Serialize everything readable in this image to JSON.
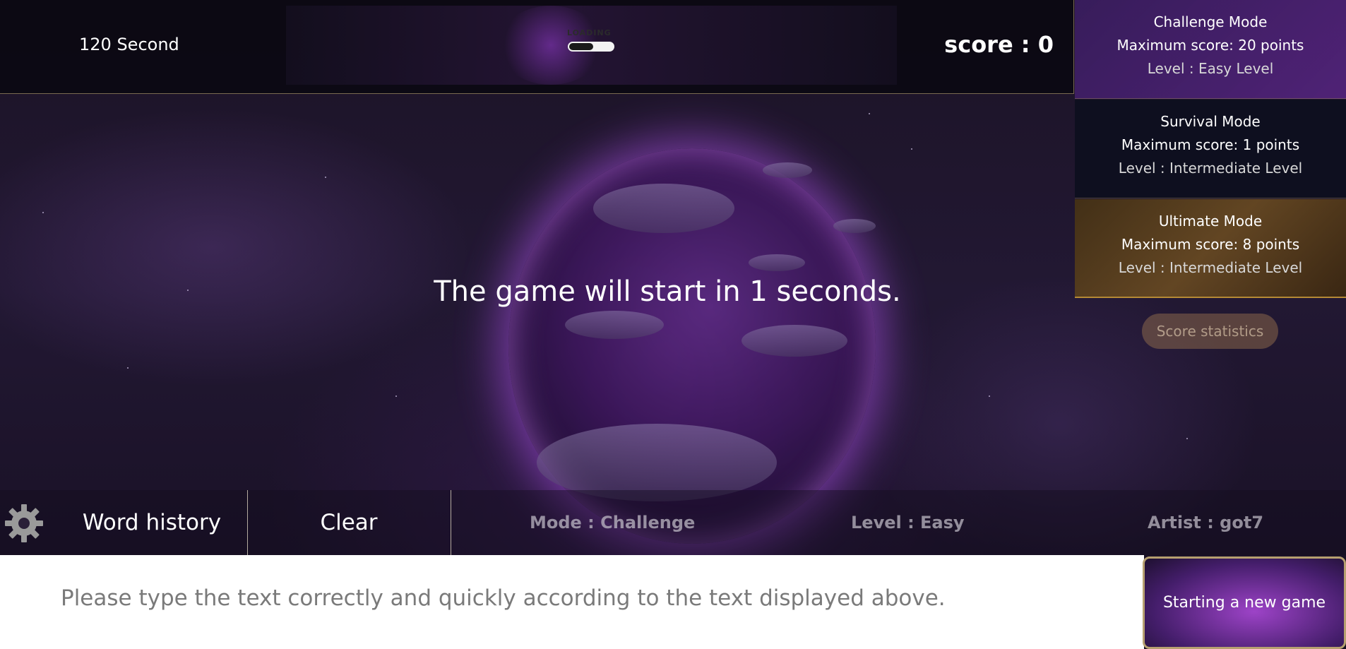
{
  "top_bar": {
    "timer": "120 Second",
    "loading_label": "LOADING",
    "loading_progress": 0.55,
    "score": "score : 0"
  },
  "modes": [
    {
      "name": "Challenge Mode",
      "max_score": "Maximum score: 20 points",
      "level": "Level : Easy Level"
    },
    {
      "name": "Survival Mode",
      "max_score": "Maximum score: 1 points",
      "level": "Level : Intermediate Level"
    },
    {
      "name": "Ultimate Mode",
      "max_score": "Maximum score: 8 points",
      "level": "Level : Intermediate Level"
    }
  ],
  "score_statistics_label": "Score statistics",
  "countdown": "The game will start in 1 seconds.",
  "controls": {
    "settings_icon": "gear-icon",
    "word_history": "Word history",
    "clear": "Clear",
    "mode": "Mode : Challenge",
    "level": "Level : Easy",
    "artist": "Artist : got7"
  },
  "input": {
    "value": "",
    "placeholder": "Please type the text correctly and quickly according to the text displayed above."
  },
  "new_game_label": "Starting a new game",
  "colors": {
    "accent_gold": "#b7a070",
    "space_purple": "#221833",
    "glow_violet": "#be5af0"
  }
}
